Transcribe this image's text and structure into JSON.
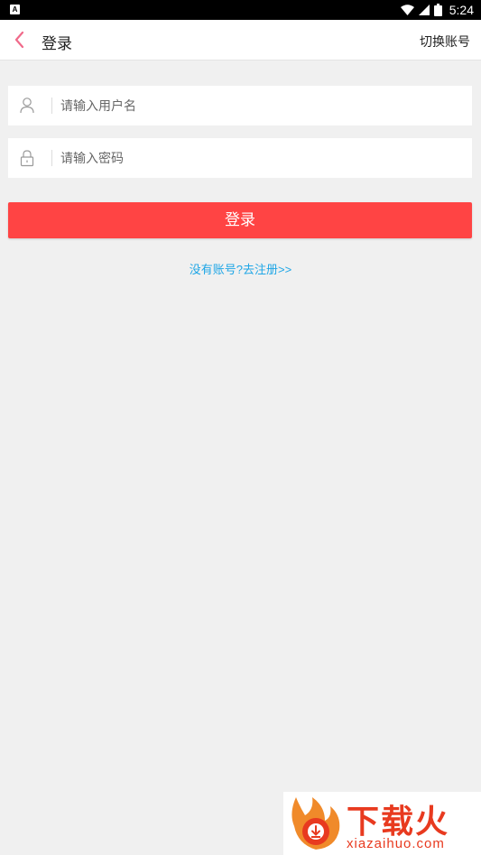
{
  "status_bar": {
    "app_badge": "A",
    "time": "5:24",
    "icons": [
      "wifi-icon",
      "signal-icon",
      "battery-icon"
    ]
  },
  "header": {
    "back_icon": "chevron-left-icon",
    "title": "登录",
    "switch_account": "切换账号"
  },
  "form": {
    "username": {
      "icon": "user-icon",
      "placeholder": "请输入用户名",
      "value": ""
    },
    "password": {
      "icon": "lock-icon",
      "placeholder": "请输入密码",
      "value": ""
    },
    "login_label": "登录",
    "register_link": "没有账号?去注册>>"
  },
  "watermark": {
    "brand": "下载火",
    "url": "xiazaihuo.com"
  },
  "colors": {
    "primary_button": "#ff4444",
    "link": "#1fa6e6",
    "back_arrow": "#f06a8a",
    "background": "#f0f0f0",
    "watermark": "#e83a1f"
  }
}
